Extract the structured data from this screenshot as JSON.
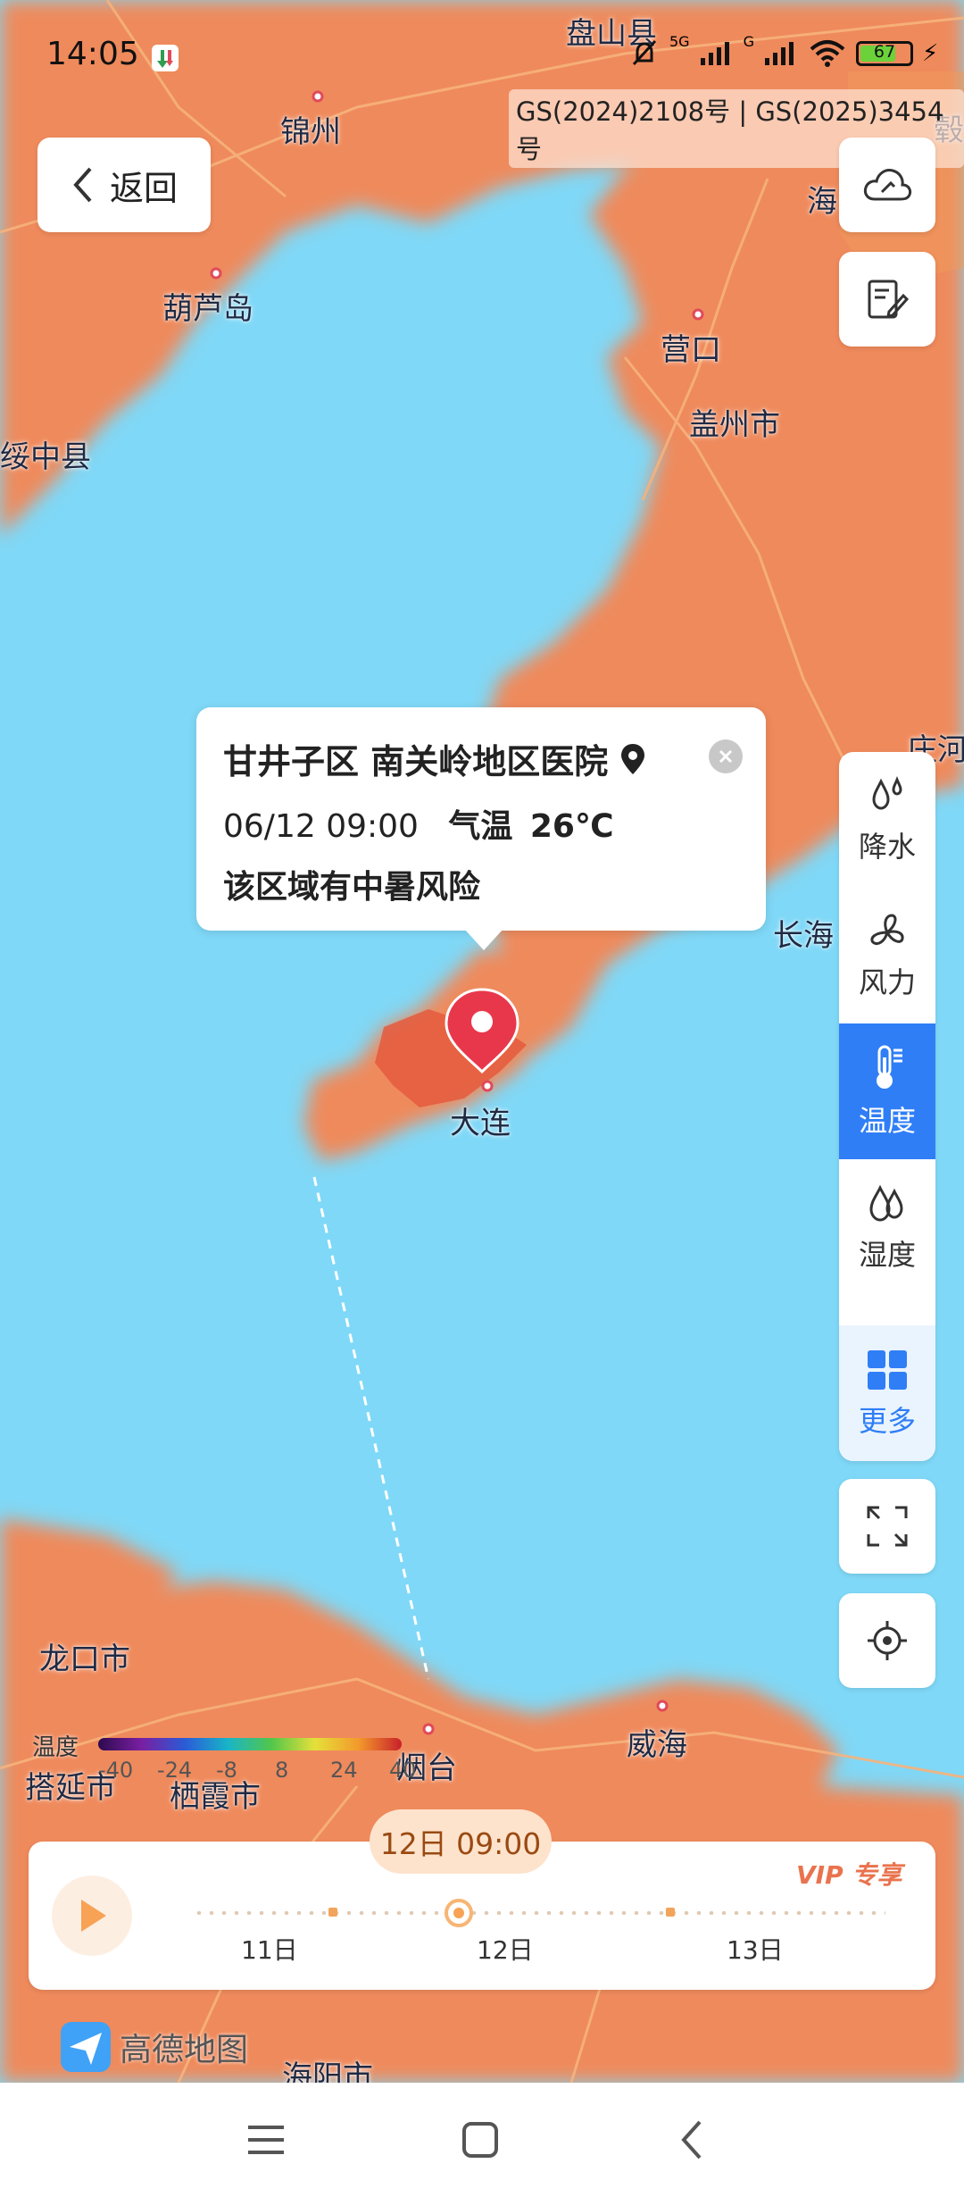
{
  "status_bar": {
    "time": "14:05",
    "network_5g": "5G",
    "network_g": "G",
    "battery": "67"
  },
  "map": {
    "approval_numbers": "GS(2024)2108号 | GS(2025)3454号",
    "labels": {
      "panshan": "盘山县",
      "jinzhou": "锦州",
      "huludao": "葫芦岛",
      "suizhong": "绥中县",
      "yingkou": "营口",
      "gaizhou": "盖州市",
      "changhai": "长海",
      "dalian": "大连",
      "longkou": "龙口市",
      "penglai": "搭延市",
      "qixia": "栖霞市",
      "yantai": "烟台",
      "weihai": "威海",
      "haiyang": "海阳市",
      "hai_edge": "海",
      "zhuanghe_edge": "庄河",
      "cut_left": "毂"
    },
    "logo_text": "高德地图"
  },
  "back_button": {
    "label": "返回"
  },
  "popup": {
    "location": "甘井子区 南关岭地区医院",
    "time": "06/12 09:00",
    "temp_label": "气温",
    "temp_value": "26℃",
    "warning": "该区域有中暑风险"
  },
  "layers": [
    {
      "label": "降水"
    },
    {
      "label": "风力"
    },
    {
      "label": "温度"
    },
    {
      "label": "湿度"
    },
    {
      "label": "更多"
    }
  ],
  "legend": {
    "title": "温度",
    "ticks": [
      "-40",
      "-24",
      "-8",
      "8",
      "24",
      "40"
    ]
  },
  "timeline": {
    "current_time": "12日 09:00",
    "days": [
      "11日",
      "12日",
      "13日"
    ],
    "vip_label": "VIP 专享",
    "current_position_fraction": 0.4
  },
  "colors": {
    "sea": "#7fd8f7",
    "land": "#ef8a5c",
    "accent": "#2f7ef6",
    "marker": "#e8374b"
  }
}
